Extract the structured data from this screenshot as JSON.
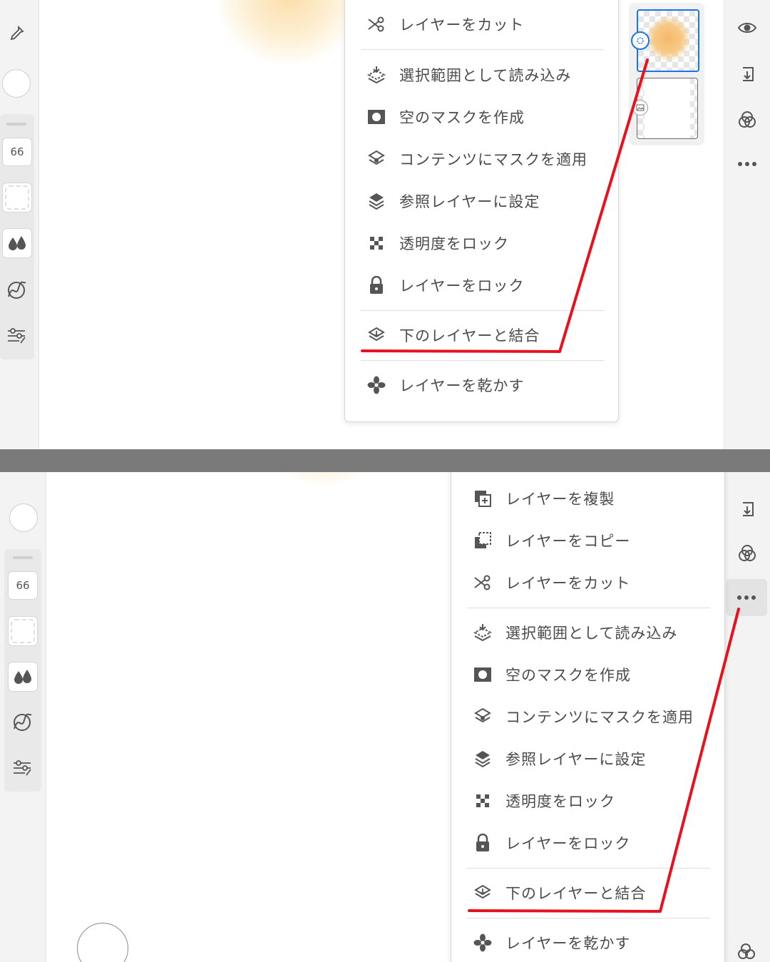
{
  "top_panel": {
    "brush_size": "66",
    "menu_items": [
      {
        "id": "cut",
        "icon": "scissors-icon",
        "label": "レイヤーをカット"
      },
      {
        "id": "load-selection",
        "icon": "load-selection-icon",
        "label": "選択範囲として読み込み"
      },
      {
        "id": "empty-mask",
        "icon": "mask-icon",
        "label": "空のマスクを作成"
      },
      {
        "id": "apply-mask",
        "icon": "layers-mask-icon",
        "label": "コンテンツにマスクを適用"
      },
      {
        "id": "reference",
        "icon": "reference-layer-icon",
        "label": "参照レイヤーに設定"
      },
      {
        "id": "lock-transparency",
        "icon": "checker-icon",
        "label": "透明度をロック"
      },
      {
        "id": "lock-layer",
        "icon": "lock-icon",
        "label": "レイヤーをロック"
      },
      {
        "id": "merge-down",
        "icon": "merge-down-icon",
        "label": "下のレイヤーと結合"
      },
      {
        "id": "dry",
        "icon": "fan-icon",
        "label": "レイヤーを乾かす"
      }
    ]
  },
  "bottom_panel": {
    "brush_size": "66",
    "menu_items": [
      {
        "id": "duplicate",
        "icon": "duplicate-icon",
        "label": "レイヤーを複製"
      },
      {
        "id": "copy",
        "icon": "copy-icon",
        "label": "レイヤーをコピー"
      },
      {
        "id": "cut",
        "icon": "scissors-icon",
        "label": "レイヤーをカット"
      },
      {
        "id": "load-selection",
        "icon": "load-selection-icon",
        "label": "選択範囲として読み込み"
      },
      {
        "id": "empty-mask",
        "icon": "mask-icon",
        "label": "空のマスクを作成"
      },
      {
        "id": "apply-mask",
        "icon": "layers-mask-icon",
        "label": "コンテンツにマスクを適用"
      },
      {
        "id": "reference",
        "icon": "reference-layer-icon",
        "label": "参照レイヤーに設定"
      },
      {
        "id": "lock-transparency",
        "icon": "checker-icon",
        "label": "透明度をロック"
      },
      {
        "id": "lock-layer",
        "icon": "lock-icon",
        "label": "レイヤーをロック"
      },
      {
        "id": "merge-down",
        "icon": "merge-down-icon",
        "label": "下のレイヤーと結合"
      },
      {
        "id": "dry",
        "icon": "fan-icon",
        "label": "レイヤーを乾かす"
      }
    ]
  },
  "colors": {
    "annotation_red": "#e8121e",
    "selection_blue": "#1a73e8",
    "paint_orange": "#f7c96e",
    "icon_gray": "#555555"
  }
}
